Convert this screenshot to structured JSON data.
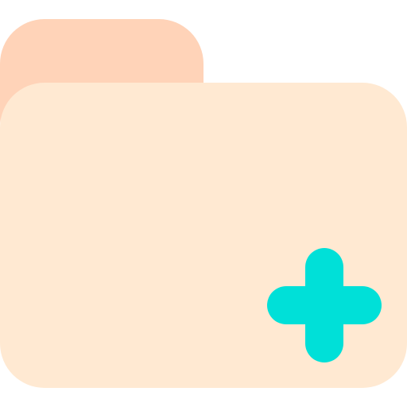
{
  "icon": {
    "name": "folder-add-icon",
    "colors": {
      "folder_tab": "#FFD3B8",
      "folder_body": "#FFE9D2",
      "plus": "#00E0D8"
    }
  }
}
